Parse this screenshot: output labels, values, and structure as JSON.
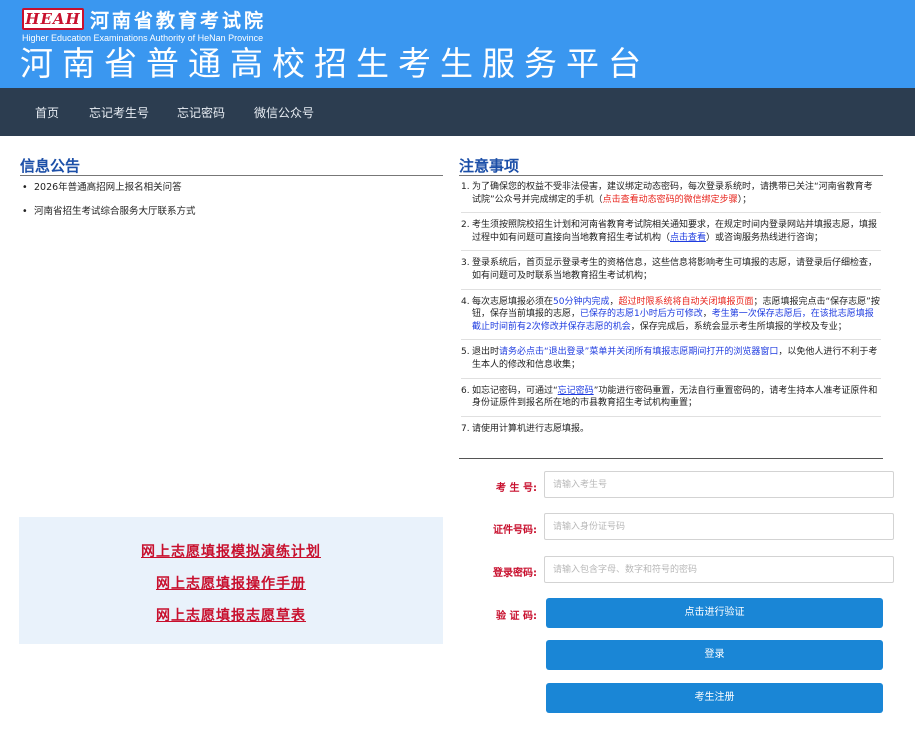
{
  "header": {
    "logo_text": "HEAH",
    "org_name": "河南省教育考试院",
    "org_name_en": "Higher Education Examinations Authority of HeNan Province",
    "platform_title": "河南省普通高校招生考生服务平台"
  },
  "nav": {
    "items": [
      {
        "label": "首页"
      },
      {
        "label": "忘记考生号"
      },
      {
        "label": "忘记密码"
      },
      {
        "label": "微信公众号"
      }
    ]
  },
  "notices": {
    "title": "信息公告",
    "items": [
      {
        "label": "2026年普通高招网上报名相关问答"
      },
      {
        "label": "河南省招生考试综合服务大厅联系方式"
      }
    ]
  },
  "promo": {
    "links": [
      {
        "label": "网上志愿填报模拟演练计划"
      },
      {
        "label": "网上志愿填报操作手册"
      },
      {
        "label": "网上志愿填报志愿草表"
      }
    ]
  },
  "notes": {
    "title": "注意事项",
    "items": [
      {
        "num": "1.",
        "segments": [
          {
            "text": "为了确保您的权益不受非法侵害，建议绑定动态密码，每次登录系统时，请携带已关注“河南省教育考试院”公众号并完成绑定的手机（",
            "style": "plain"
          },
          {
            "text": "点击查看动态密码的微信绑定步骤",
            "style": "red"
          },
          {
            "text": "）；",
            "style": "plain"
          }
        ]
      },
      {
        "num": "2.",
        "segments": [
          {
            "text": "考生须按照院校招生计划和河南省教育考试院相关通知要求，在规定时间内登录网站并填报志愿，填报过程中如有问题可直接向当地教育招生考试机构（",
            "style": "plain"
          },
          {
            "text": "点击查看",
            "style": "link"
          },
          {
            "text": "）或咨询服务热线进行咨询；",
            "style": "plain"
          }
        ]
      },
      {
        "num": "3.",
        "segments": [
          {
            "text": "登录系统后，首页显示登录考生的资格信息，这些信息将影响考生可填报的志愿，请登录后仔细检查，如有问题可及时联系当地教育招生考试机构；",
            "style": "plain"
          }
        ]
      },
      {
        "num": "4.",
        "segments": [
          {
            "text": "每次志愿填报必须在",
            "style": "plain"
          },
          {
            "text": "50分钟内完成",
            "style": "blue"
          },
          {
            "text": "，",
            "style": "plain"
          },
          {
            "text": "超过时限系统将自动关闭填报页面",
            "style": "red"
          },
          {
            "text": "；志愿填报完点击“保存志愿”按钮，保存当前填报的志愿，",
            "style": "plain"
          },
          {
            "text": "已保存的志愿1小时后方可修改",
            "style": "blue"
          },
          {
            "text": "，",
            "style": "plain"
          },
          {
            "text": "考生第一次保存志愿后，在该批志愿填报截止时间前有2次修改并保存志愿的机会",
            "style": "blue"
          },
          {
            "text": "，保存完成后，系统会显示考生所填报的学校及专业；",
            "style": "plain"
          }
        ]
      },
      {
        "num": "5.",
        "segments": [
          {
            "text": "退出时",
            "style": "plain"
          },
          {
            "text": "请务必点击“退出登录”菜单并关闭所有填报志愿期间打开的浏览器窗口",
            "style": "blue"
          },
          {
            "text": "，以免他人进行不利于考生本人的修改和信息收集；",
            "style": "plain"
          }
        ]
      },
      {
        "num": "6.",
        "segments": [
          {
            "text": "如忘记密码，可通过“",
            "style": "plain"
          },
          {
            "text": "忘记密码",
            "style": "link"
          },
          {
            "text": "”功能进行密码重置，无法自行重置密码的，请考生持本人准考证原件和身份证原件到报名所在地的市县教育招生考试机构重置；",
            "style": "plain"
          }
        ]
      },
      {
        "num": "7.",
        "segments": [
          {
            "text": "请使用计算机进行志愿填报。",
            "style": "plain"
          }
        ]
      }
    ]
  },
  "login": {
    "exam_no_label": "考 生 号:",
    "exam_no_placeholder": "请输入考生号",
    "id_label": "证件号码:",
    "id_placeholder": "请输入身份证号码",
    "password_label": "登录密码:",
    "password_placeholder": "请输入包含字母、数字和符号的密码",
    "captcha_label": "验 证 码:",
    "verify_button": "点击进行验证",
    "login_button": "登录",
    "register_button": "考生注册"
  },
  "colors": {
    "header_blue": "#3a97f0",
    "nav_dark": "#2c3d50",
    "accent_red": "#c8102e",
    "button_blue": "#1a86d6",
    "title_blue": "#1c4fa8"
  }
}
